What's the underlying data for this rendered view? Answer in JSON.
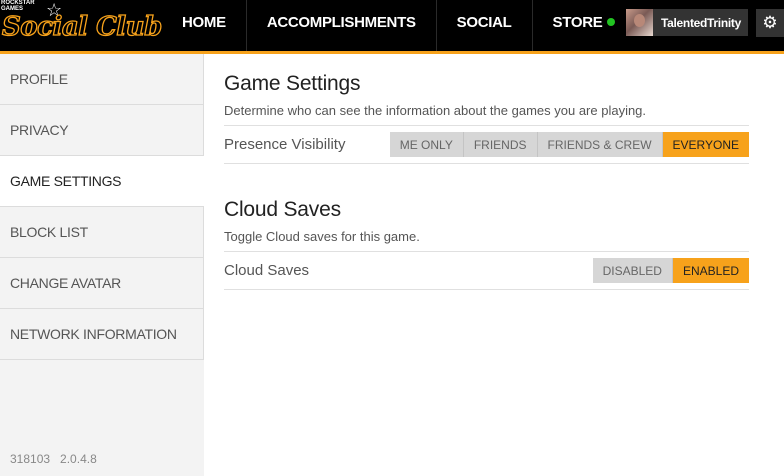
{
  "logo": {
    "small_text": "ROCKSTAR GAMES",
    "script_text": "Social Club"
  },
  "nav": {
    "items": [
      "HOME",
      "ACCOMPLISHMENTS",
      "SOCIAL",
      "STORE"
    ]
  },
  "user": {
    "name": "TalentedTrinity",
    "online_color": "#22c422"
  },
  "colors": {
    "accent": "#f7a21b",
    "topbar": "#000000"
  },
  "sidebar": {
    "items": [
      {
        "label": "PROFILE"
      },
      {
        "label": "PRIVACY"
      },
      {
        "label": "GAME SETTINGS"
      },
      {
        "label": "BLOCK LIST"
      },
      {
        "label": "CHANGE AVATAR"
      },
      {
        "label": "NETWORK INFORMATION"
      }
    ],
    "active_index": 2,
    "version_left": "318103",
    "version_right": "2.0.4.8"
  },
  "game_settings": {
    "title": "Game Settings",
    "description": "Determine who can see the information about the games you are playing.",
    "presence": {
      "label": "Presence Visibility",
      "options": [
        "ME ONLY",
        "FRIENDS",
        "FRIENDS & CREW",
        "EVERYONE"
      ],
      "selected": "EVERYONE"
    }
  },
  "cloud_saves": {
    "title": "Cloud Saves",
    "description": "Toggle Cloud saves for this game.",
    "toggle": {
      "label": "Cloud Saves",
      "options": [
        "DISABLED",
        "ENABLED"
      ],
      "selected": "ENABLED"
    }
  }
}
